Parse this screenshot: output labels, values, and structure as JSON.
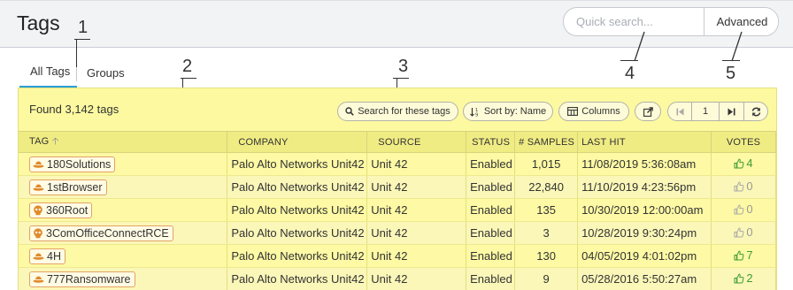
{
  "header": {
    "title": "Tags",
    "search_placeholder": "Quick search...",
    "advanced_label": "Advanced"
  },
  "annotations": [
    "1",
    "2",
    "3",
    "4",
    "5"
  ],
  "tabs": [
    {
      "label": "All Tags",
      "active": true
    },
    {
      "label": "Groups",
      "active": false
    }
  ],
  "toolbar": {
    "found_text": "Found 3,142 tags",
    "search_tags_label": "Search for these tags",
    "sort_label": "Sort by: Name",
    "columns_label": "Columns",
    "page_number": "1"
  },
  "table": {
    "headers": [
      "TAG",
      "COMPANY",
      "SOURCE",
      "STATUS",
      "# SAMPLES",
      "LAST HIT",
      "VOTES"
    ],
    "rows": [
      {
        "tag": "180Solutions",
        "icon": "hat-icon",
        "company": "Palo Alto Networks Unit42",
        "source": "Unit 42",
        "status": "Enabled",
        "samples": "1,015",
        "last_hit": "11/08/2019 5:36:08am",
        "votes": "4",
        "voted": true
      },
      {
        "tag": "1stBrowser",
        "icon": "hat-icon",
        "company": "Palo Alto Networks Unit42",
        "source": "Unit 42",
        "status": "Enabled",
        "samples": "22,840",
        "last_hit": "11/10/2019 4:23:56pm",
        "votes": "0",
        "voted": false
      },
      {
        "tag": "360Root",
        "icon": "skull-icon",
        "company": "Palo Alto Networks Unit42",
        "source": "Unit 42",
        "status": "Enabled",
        "samples": "135",
        "last_hit": "10/30/2019 12:00:00am",
        "votes": "0",
        "voted": false
      },
      {
        "tag": "3ComOfficeConnectRCE",
        "icon": "skull-icon",
        "company": "Palo Alto Networks Unit42",
        "source": "Unit 42",
        "status": "Enabled",
        "samples": "3",
        "last_hit": "10/28/2019 9:30:24pm",
        "votes": "0",
        "voted": false
      },
      {
        "tag": "4H",
        "icon": "hat-icon",
        "company": "Palo Alto Networks Unit42",
        "source": "Unit 42",
        "status": "Enabled",
        "samples": "130",
        "last_hit": "04/05/2019 4:01:02pm",
        "votes": "7",
        "voted": true
      },
      {
        "tag": "777Ransomware",
        "icon": "hat-icon",
        "company": "Palo Alto Networks Unit42",
        "source": "Unit 42",
        "status": "Enabled",
        "samples": "9",
        "last_hit": "05/28/2016 5:50:27am",
        "votes": "2",
        "voted": true
      }
    ]
  },
  "colors": {
    "accent": "#2a9fd6",
    "highlight": "#fcf9a0",
    "vote_up": "#3f9c35"
  }
}
